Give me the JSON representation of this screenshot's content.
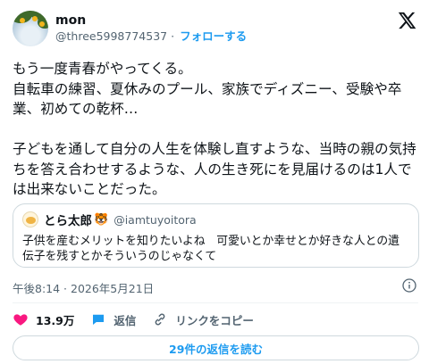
{
  "author": {
    "display_name": "mon",
    "handle": "@three5998774537",
    "separator": "·",
    "follow_label": "フォローする"
  },
  "tweet": {
    "text": "もう一度青春がやってくる。\n自転車の練習、夏休みのプール、家族でディズニー、受験や卒業、初めての乾杯…\n\n子どもを通して自分の人生を体験し直すような、当時の親の気持ちを答え合わせするような、人の生き死にを見届けるのは1人では出来ないことだった。"
  },
  "quote": {
    "display_name": "とら太郎",
    "emoji": "🐯",
    "handle": "@iamtuyoitora",
    "text": "子供を産むメリットを知りたいよね　可愛いとか幸せとか好きな人との遺伝子を残すとかそういうのじゃなくて"
  },
  "meta": {
    "timestamp": "午後8:14 · 2026年5月21日"
  },
  "actions": {
    "likes": "13.9万",
    "reply_label": "返信",
    "copy_link_label": "リンクをコピー"
  },
  "footer": {
    "read_replies_label": "29件の返信を読む"
  },
  "colors": {
    "accent": "#1d9bf0",
    "like": "#f91880",
    "text": "#0f1419",
    "secondary": "#536471"
  }
}
